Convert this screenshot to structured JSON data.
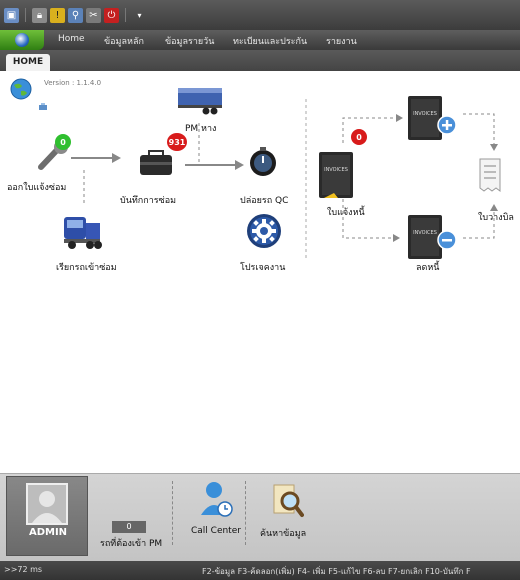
{
  "menu": {
    "items": [
      "Home",
      "ข้อมูลหลัก",
      "ข้อมูลรายวัน",
      "ทะเบียนและประกัน",
      "รายงาน"
    ]
  },
  "tabs": {
    "home": "HOME"
  },
  "version_text": "Version : 1.1.4.0",
  "flow": {
    "open_repair": "ออกใบแจ้งซ่อม",
    "open_repair_badge": "0",
    "repair_record": "บันทึกการซ่อม",
    "repair_record_badge": "931",
    "pm_due": "PM หาง",
    "release_qc": "ปล่อยรถ QC",
    "call_vehicle": "เรียกรถเข้าซ่อม",
    "job_process": "โปรเจคงาน"
  },
  "invoice": {
    "debit_note": "ใบแจ้งหนี้",
    "debit_badge": "0",
    "credit_note": "ลดหนี้",
    "receipt": "ใบวางบิล",
    "book_text": "INVOICES"
  },
  "bottom": {
    "user": "ADMIN",
    "pm_count": "0",
    "pm_label": "รถที่ต้องเข้า PM",
    "call_center": "Call Center",
    "search_data": "ค้นหาข้อมูล"
  },
  "status": {
    "timing": ">>72 ms",
    "shortcuts": "F2-ข้อมูล  F3-ค้ดลอก(เพิ่ม) F4- เพิ่ม  F5-แก้ไข  F6-ลบ  F7-ยกเลิก  F10-บันทึก F"
  },
  "colors": {
    "badge_green": "#2fbf2f",
    "badge_red": "#d81b1b",
    "app_button": "#3f9a1e"
  }
}
